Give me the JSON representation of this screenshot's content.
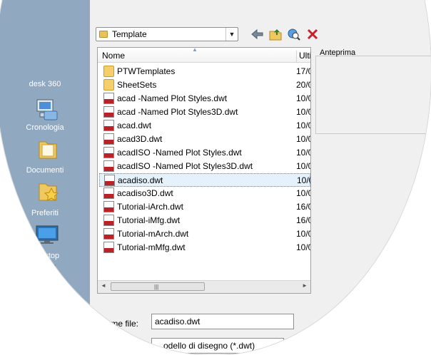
{
  "places": [
    {
      "label": "desk 360",
      "icon": "cloud-storage-icon"
    },
    {
      "label": "Cronologia",
      "icon": "history-icon"
    },
    {
      "label": "Documenti",
      "icon": "documents-folder-icon"
    },
    {
      "label": "Preferiti",
      "icon": "favorites-folder-icon"
    },
    {
      "label": "Desktop",
      "icon": "desktop-monitor-icon"
    },
    {
      "label": "",
      "icon": "search-ftp-icon"
    }
  ],
  "lookin": {
    "value": "Template"
  },
  "toolbar": [
    "back-arrow-icon",
    "up-folder-icon",
    "search-web-icon",
    "delete-icon"
  ],
  "columns": {
    "name": "Nome",
    "date": "Ulti"
  },
  "files": [
    {
      "name": "PTWTemplates",
      "date": "17/0",
      "type": "folder"
    },
    {
      "name": "SheetSets",
      "date": "20/0",
      "type": "folder"
    },
    {
      "name": "acad -Named Plot Styles.dwt",
      "date": "10/0",
      "type": "dwt"
    },
    {
      "name": "acad -Named Plot Styles3D.dwt",
      "date": "10/0",
      "type": "dwt"
    },
    {
      "name": "acad.dwt",
      "date": "10/0",
      "type": "dwt"
    },
    {
      "name": "acad3D.dwt",
      "date": "10/0",
      "type": "dwt"
    },
    {
      "name": "acadISO -Named Plot Styles.dwt",
      "date": "10/0",
      "type": "dwt"
    },
    {
      "name": "acadISO -Named Plot Styles3D.dwt",
      "date": "10/0",
      "type": "dwt"
    },
    {
      "name": "acadiso.dwt",
      "date": "10/0",
      "type": "dwt",
      "selected": true
    },
    {
      "name": "acadiso3D.dwt",
      "date": "10/0",
      "type": "dwt"
    },
    {
      "name": "Tutorial-iArch.dwt",
      "date": "16/0",
      "type": "dwt"
    },
    {
      "name": "Tutorial-iMfg.dwt",
      "date": "16/0",
      "type": "dwt"
    },
    {
      "name": "Tutorial-mArch.dwt",
      "date": "10/0",
      "type": "dwt"
    },
    {
      "name": "Tutorial-mMfg.dwt",
      "date": "10/0",
      "type": "dwt"
    }
  ],
  "preview": {
    "label": "Anteprima"
  },
  "filename": {
    "label": "Nome file:",
    "value": "acadiso.dwt"
  },
  "filetype": {
    "value": "...odello di disegno (*.dwt)"
  }
}
